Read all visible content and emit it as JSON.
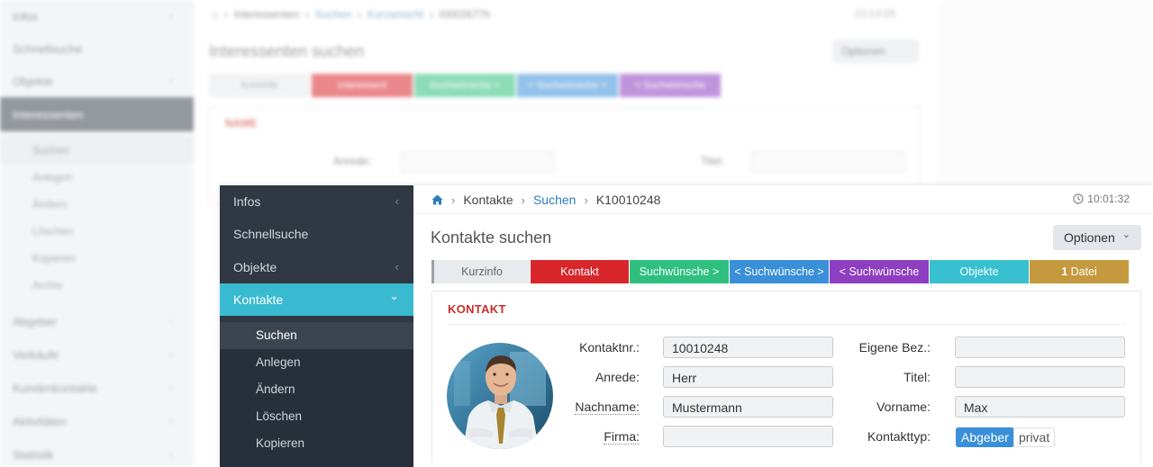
{
  "background_window": {
    "sidebar_items": [
      {
        "label": "Infos",
        "chevron": true
      },
      {
        "label": "Schnellsuche",
        "chevron": false
      },
      {
        "label": "Objekte",
        "chevron": true
      }
    ],
    "active_item": "Interessenten",
    "sub_items": [
      "Suchen",
      "Anlegen",
      "Ändern",
      "Löschen",
      "Kopieren",
      "Archiv"
    ],
    "lower_items": [
      "Abgeber",
      "Verkäufe",
      "Kundenkontakte",
      "Aktivitäten",
      "Statistik"
    ],
    "breadcrumb": [
      "Interessenten",
      "Suchen",
      "Kurzansicht",
      "I0002677h"
    ],
    "time": "10:14:05",
    "title": "Interessenten suchen",
    "options_label": "Optionen",
    "tabs": [
      {
        "label": "Kurzinfo",
        "color": "#e8eaed"
      },
      {
        "label": "Interessent",
        "color": "#d9262b"
      },
      {
        "label": "Suchwünsche >",
        "color": "#2fc07f"
      },
      {
        "label": "< Suchwünsche >",
        "color": "#3a8fd9"
      },
      {
        "label": "< Suchwünsche",
        "color": "#8e3ec0"
      }
    ],
    "panel_heading": "NAME",
    "fields": [
      "Anrede:",
      "Titel:"
    ]
  },
  "sidebar": {
    "items": [
      {
        "label": "Infos",
        "chevron": "‹"
      },
      {
        "label": "Schnellsuche",
        "chevron": ""
      },
      {
        "label": "Objekte",
        "chevron": "‹"
      },
      {
        "label": "Kontakte",
        "chevron": "⌄"
      }
    ],
    "sub_items": [
      "Suchen",
      "Anlegen",
      "Ändern",
      "Löschen",
      "Kopieren"
    ]
  },
  "breadcrumb": {
    "home_icon": "home-icon",
    "items": [
      "Kontakte",
      "Suchen",
      "K10010248"
    ]
  },
  "clock": {
    "icon": "clock-icon",
    "time": "10:01:32"
  },
  "page_title": "Kontakte suchen",
  "options_button": {
    "label": "Optionen",
    "caret": "⌄"
  },
  "tabs": [
    {
      "label": "Kurzinfo",
      "color": "#e8eaed"
    },
    {
      "label": "Kontakt",
      "color": "#d9262b"
    },
    {
      "label": "Suchwünsche >",
      "color": "#2fc07f"
    },
    {
      "label": "< Suchwünsche >",
      "color": "#3a8fd9"
    },
    {
      "label": "< Suchwünsche",
      "color": "#8e3ec0"
    },
    {
      "label": "Objekte",
      "color": "#36c0d0"
    },
    {
      "count": "1",
      "label": "Datei",
      "color": "#c59a3e"
    }
  ],
  "panel": {
    "heading": "KONTAKT",
    "fields": {
      "kontaktnr": {
        "label": "Kontaktnr.:",
        "value": "10010248"
      },
      "anrede": {
        "label": "Anrede:",
        "value": "Herr"
      },
      "nachname": {
        "label": "Nachname:",
        "value": "Mustermann"
      },
      "firma": {
        "label": "Firma:",
        "value": ""
      },
      "eigene_bez": {
        "label": "Eigene Bez.:",
        "value": ""
      },
      "titel": {
        "label": "Titel:",
        "value": ""
      },
      "vorname": {
        "label": "Vorname:",
        "value": "Max"
      },
      "kontakttyp": {
        "label": "Kontakttyp:",
        "options": [
          "Abgeber",
          "privat"
        ],
        "selected": "Abgeber"
      }
    }
  },
  "colors": {
    "accent": "#39bad0",
    "sidebar_bg": "#2f3843",
    "heading_red": "#c9302c",
    "link": "#2d7bbf"
  }
}
